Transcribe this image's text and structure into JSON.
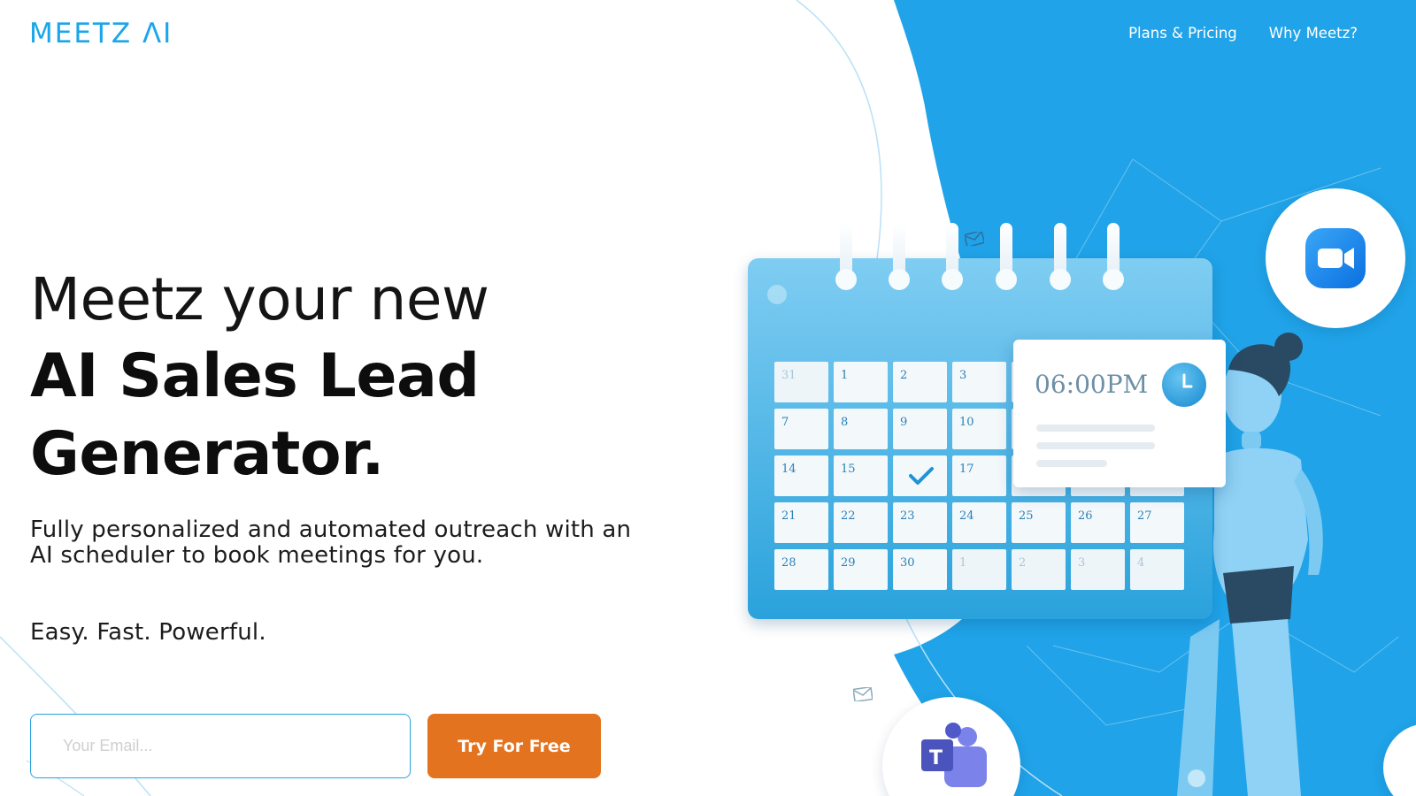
{
  "brand": {
    "logo_text": "MEETZ ΛI",
    "accent_color": "#1aa6e8",
    "background_blue": "#20a3e8",
    "cta_color": "#e3731f"
  },
  "nav": {
    "items": [
      {
        "label": "Plans & Pricing"
      },
      {
        "label": "Why Meetz?"
      }
    ]
  },
  "hero": {
    "headline_line1": "Meetz your new",
    "headline_line2": "AI Sales Lead",
    "headline_line3": "Generator.",
    "subtitle": "Fully personalized and automated outreach with an AI scheduler to book meetings for you.",
    "tagline": "Easy. Fast. Powerful."
  },
  "signup": {
    "email_placeholder": "Your Email...",
    "email_value": "",
    "button_label": "Try For Free"
  },
  "illustration": {
    "calendar": {
      "days": [
        "31",
        "1",
        "2",
        "3",
        "",
        "",
        "",
        "7",
        "8",
        "9",
        "10",
        "",
        "",
        "",
        "14",
        "15",
        "",
        "17",
        "",
        "",
        "",
        "21",
        "22",
        "23",
        "24",
        "25",
        "26",
        "27",
        "28",
        "29",
        "30",
        "1",
        "2",
        "3",
        "4"
      ],
      "checked_day_index": 16,
      "muted_indices": [
        0,
        31,
        32,
        33,
        34
      ]
    },
    "time_card": {
      "time": "06:00PM"
    },
    "icons": [
      "zoom-icon",
      "teams-icon",
      "envelope-icon",
      "clock-icon",
      "check-icon",
      "robot-figure"
    ]
  }
}
